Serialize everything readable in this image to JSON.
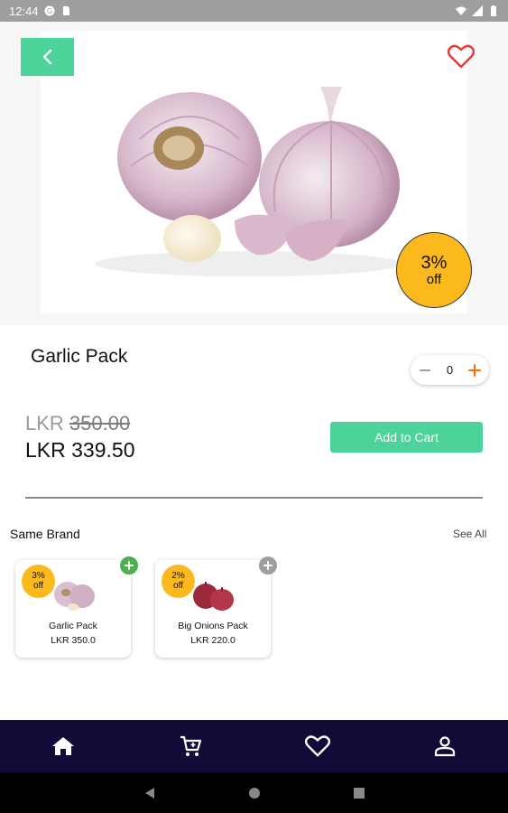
{
  "status_bar": {
    "time": "12:44"
  },
  "product": {
    "name": "Garlic Pack",
    "discount_pct": "3%",
    "discount_off": "off",
    "old_price_currency": "LKR",
    "old_price_value": "350.00",
    "new_price": "LKR 339.50",
    "quantity": "0",
    "add_to_cart_label": "Add to Cart"
  },
  "same_brand": {
    "title": "Same Brand",
    "see_all": "See All",
    "items": [
      {
        "discount_pct": "3%",
        "discount_off": "off",
        "name": "Garlic Pack",
        "price": "LKR 350.0",
        "add_color": "#4caf50"
      },
      {
        "discount_pct": "2%",
        "discount_off": "off",
        "name": "Big Onions Pack",
        "price": "LKR 220.0",
        "add_color": "#9e9e9e"
      }
    ]
  },
  "colors": {
    "accent": "#4cd39a",
    "badge": "#fbb91d",
    "nav_bg": "#140a38",
    "heart": "#e53935",
    "qty_plus": "#ff6d00"
  },
  "icons": {
    "back": "chevron-left-icon",
    "favorite": "heart-outline-icon",
    "minus": "minus-icon",
    "plus": "plus-icon",
    "nav": [
      "home-icon",
      "cart-icon",
      "heart-icon",
      "person-icon"
    ],
    "system": [
      "back-triangle-icon",
      "home-circle-icon",
      "recents-square-icon"
    ]
  }
}
